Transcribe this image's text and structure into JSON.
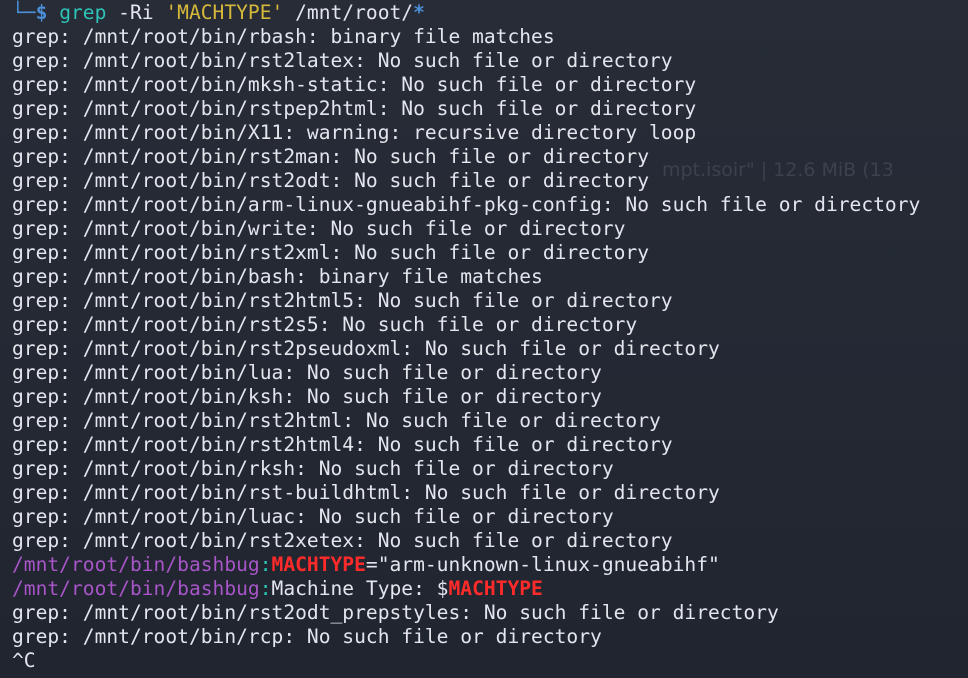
{
  "terminal": {
    "command": {
      "corner": "└─",
      "dollar": "$",
      "program": "grep",
      "flags": "-Ri",
      "pattern": "'MACHTYPE'",
      "path": "/mnt/root/",
      "glob": "*"
    },
    "ghost_text": "mpt.isoir\" | 12.6 MiB (13",
    "output_before": [
      "grep: /mnt/root/bin/rbash: binary file matches",
      "grep: /mnt/root/bin/rst2latex: No such file or directory",
      "grep: /mnt/root/bin/mksh-static: No such file or directory",
      "grep: /mnt/root/bin/rstpep2html: No such file or directory",
      "grep: /mnt/root/bin/X11: warning: recursive directory loop",
      "grep: /mnt/root/bin/rst2man: No such file or directory",
      "grep: /mnt/root/bin/rst2odt: No such file or directory",
      "grep: /mnt/root/bin/arm-linux-gnueabihf-pkg-config: No such file or directory",
      "grep: /mnt/root/bin/write: No such file or directory",
      "grep: /mnt/root/bin/rst2xml: No such file or directory",
      "grep: /mnt/root/bin/bash: binary file matches",
      "grep: /mnt/root/bin/rst2html5: No such file or directory",
      "grep: /mnt/root/bin/rst2s5: No such file or directory",
      "grep: /mnt/root/bin/rst2pseudoxml: No such file or directory",
      "grep: /mnt/root/bin/lua: No such file or directory",
      "grep: /mnt/root/bin/ksh: No such file or directory",
      "grep: /mnt/root/bin/rst2html: No such file or directory",
      "grep: /mnt/root/bin/rst2html4: No such file or directory",
      "grep: /mnt/root/bin/rksh: No such file or directory",
      "grep: /mnt/root/bin/rst-buildhtml: No such file or directory",
      "grep: /mnt/root/bin/luac: No such file or directory",
      "grep: /mnt/root/bin/rst2xetex: No such file or directory"
    ],
    "match1": {
      "file": "/mnt/root/bin/bashbug",
      "sep": ":",
      "highlight": "MACHTYPE",
      "rest": "=\"arm-unknown-linux-gnueabihf\""
    },
    "match2": {
      "file": "/mnt/root/bin/bashbug",
      "sep": ":",
      "pre": "Machine Type: $",
      "highlight": "MACHTYPE"
    },
    "output_after": [
      "grep: /mnt/root/bin/rst2odt_prepstyles: No such file or directory",
      "grep: /mnt/root/bin/rcp: No such file or directory"
    ],
    "interrupt": "^C"
  },
  "colors": {
    "background": "#252a34",
    "text": "#e3e6ec",
    "prompt": "#4a8fd8",
    "command": "#2ec4b8",
    "string": "#d7b93a",
    "match_file": "#a855c8",
    "match_highlight": "#ff2a2a"
  }
}
